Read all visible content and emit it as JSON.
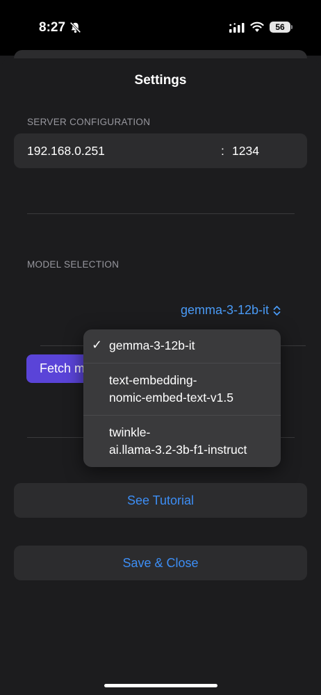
{
  "status_bar": {
    "time": "8:27",
    "battery": "56",
    "icons": [
      "bell-slash-icon",
      "cellular-signal-icon",
      "wifi-icon",
      "battery-icon"
    ]
  },
  "settings": {
    "title": "Settings",
    "server_configuration": {
      "header": "SERVER CONFIGURATION",
      "host": "192.168.0.251",
      "separator": ":",
      "port": "1234"
    },
    "model_selection": {
      "header": "MODEL SELECTION",
      "selected_model": "gemma-3-12b-it",
      "fetch_button_label": "Fetch m",
      "options": [
        {
          "lines": [
            "gemma-3-12b-it"
          ],
          "checked": true
        },
        {
          "lines": [
            "text-embedding-",
            "nomic-embed-text-v1.5"
          ],
          "checked": false
        },
        {
          "lines": [
            "twinkle-",
            "ai.llama-3.2-3b-f1-instruct"
          ],
          "checked": false
        }
      ],
      "check_mark": "✓"
    },
    "see_tutorial_label": "See Tutorial",
    "save_close_label": "Save & Close"
  },
  "colors": {
    "accent": "#3d8ef5",
    "fetch_button": "#5a44d8",
    "background": "#1c1c1e",
    "cell": "#2c2c2e"
  }
}
